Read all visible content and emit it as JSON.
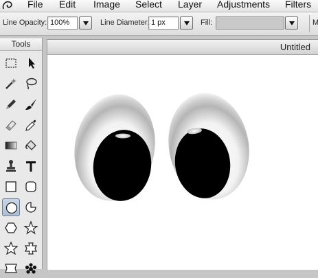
{
  "menu": {
    "app_icon": "app-swirl-icon",
    "items": [
      "File",
      "Edit",
      "Image",
      "Select",
      "Layer",
      "Adjustments",
      "Filters"
    ]
  },
  "options_bar": {
    "line_opacity": {
      "label": "Line Opacity:",
      "value": "100%"
    },
    "line_diameter": {
      "label": "Line Diameter:",
      "value": "1 px"
    },
    "fill": {
      "label": "Fill:",
      "color": "#c9c9c9"
    },
    "more_label": "M"
  },
  "tools_panel": {
    "title": "Tools",
    "tools": [
      {
        "name": "marquee-tool-icon",
        "selected": false
      },
      {
        "name": "move-arrow-tool-icon",
        "selected": false
      },
      {
        "name": "magic-wand-tool-icon",
        "selected": false
      },
      {
        "name": "lasso-tool-icon",
        "selected": false
      },
      {
        "name": "pencil-tool-icon",
        "selected": false
      },
      {
        "name": "brush-tool-icon",
        "selected": false
      },
      {
        "name": "eraser-tool-icon",
        "selected": false
      },
      {
        "name": "eyedropper-tool-icon",
        "selected": false
      },
      {
        "name": "gradient-tool-icon",
        "selected": false
      },
      {
        "name": "paint-bucket-tool-icon",
        "selected": false
      },
      {
        "name": "clone-stamp-tool-icon",
        "selected": false
      },
      {
        "name": "text-tool-icon",
        "selected": false
      },
      {
        "name": "rectangle-tool-icon",
        "selected": false
      },
      {
        "name": "rounded-rectangle-tool-icon",
        "selected": false
      },
      {
        "name": "ellipse-tool-icon",
        "selected": true
      },
      {
        "name": "pie-tool-icon",
        "selected": false
      },
      {
        "name": "hexagon-tool-icon",
        "selected": false
      },
      {
        "name": "star-tool-icon",
        "selected": false
      },
      {
        "name": "six-point-star-tool-icon",
        "selected": false
      },
      {
        "name": "puzzle-shape-tool-icon",
        "selected": false
      },
      {
        "name": "banner-shape-tool-icon",
        "selected": false
      },
      {
        "name": "flower-shape-tool-icon",
        "selected": false
      }
    ]
  },
  "document": {
    "title": "Untitled",
    "background": "#ffffff"
  },
  "colors": {
    "selected_tool": "#b8c8dc",
    "pupil": "#000000",
    "eye_white": "#ffffff",
    "eye_shade": "#a4a4a4"
  }
}
